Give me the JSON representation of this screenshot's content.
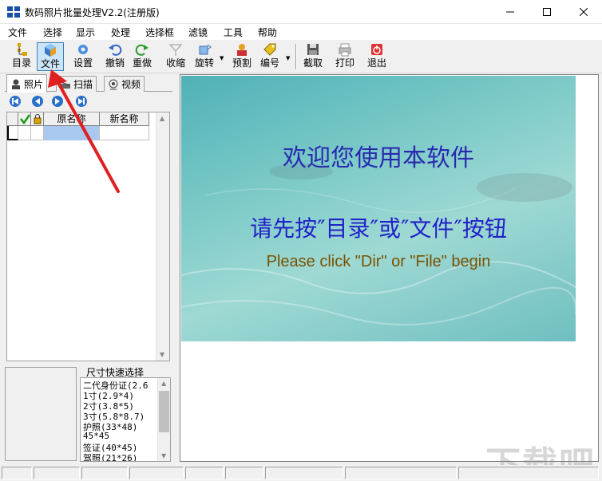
{
  "window": {
    "title": "数码照片批量处理V2.2(注册版)"
  },
  "menu": [
    "文件",
    "选择",
    "显示",
    "处理",
    "选择框",
    "滤镜",
    "工具",
    "帮助"
  ],
  "toolbar": {
    "dir": "目录",
    "file": "文件",
    "settings": "设置",
    "undo": "撤销",
    "redo": "重做",
    "shrink": "收缩",
    "rotate": "旋转",
    "preset_crop": "预割",
    "number": "编号",
    "capture": "截取",
    "print": "打印",
    "exit": "退出"
  },
  "tabs": {
    "photo": "照片",
    "scan": "扫描",
    "video": "视频"
  },
  "grid": {
    "col_original": "原名称",
    "col_new": "新名称"
  },
  "size_panel": {
    "title": "尺寸快速选择",
    "items": [
      "二代身份证(2.6",
      "1寸(2.9*4)",
      "2寸(3.8*5)",
      "3寸(5.8*8.7)",
      "护照(33*48)",
      "45*45",
      "签证(40*45)",
      "驾照(21*26)"
    ]
  },
  "welcome": {
    "line1": "欢迎您使用本软件",
    "line2": "请先按″目录″或″文件″按钮",
    "line3": "Please click \"Dir\" or \"File\" begin"
  },
  "watermark": "下载吧",
  "colors": {
    "accent_blue": "#2a6fc9",
    "active_button": "#cce4f7",
    "arrow_red": "#e02020"
  }
}
